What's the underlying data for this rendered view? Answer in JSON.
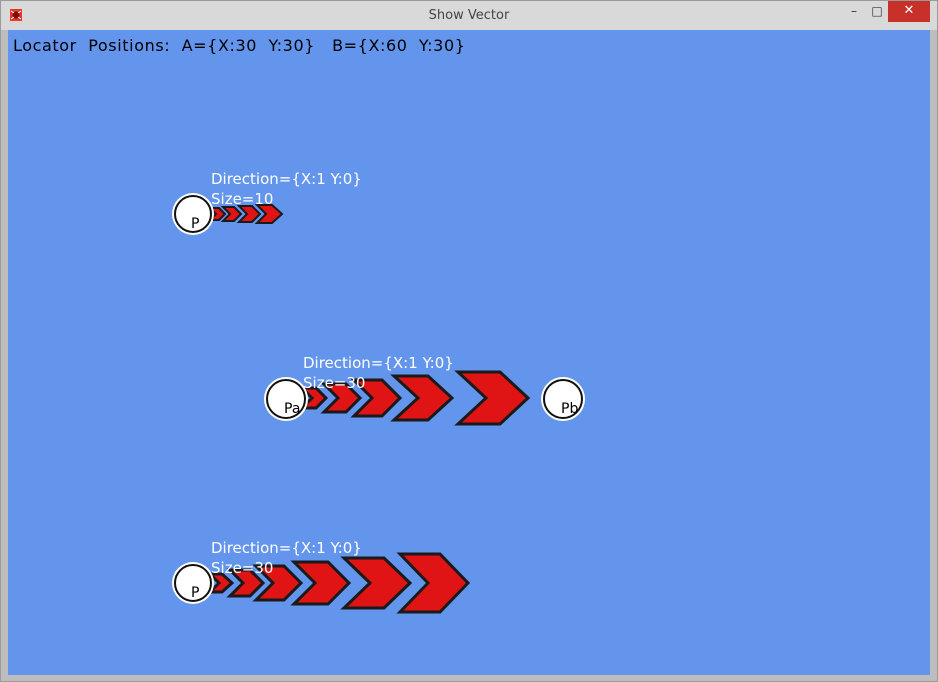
{
  "window": {
    "title": "Show Vector",
    "minimize_glyph": "–",
    "maximize_glyph": "□",
    "close_glyph": "✕",
    "app_icon": "bug-icon"
  },
  "canvas": {
    "background": "#6495ED",
    "locator_text": "Locator  Positions:  A={X:30  Y:30}   B={X:60  Y:30}"
  },
  "vectors": [
    {
      "direction_text": "Direction={X:1 Y:0}",
      "size_text": "Size=10",
      "start_label": "P",
      "end_label": null
    },
    {
      "direction_text": "Direction={X:1 Y:0}",
      "size_text": "Size=30",
      "start_label": "Pa",
      "end_label": "Pb"
    },
    {
      "direction_text": "Direction={X:1 Y:0}",
      "size_text": "Size=30",
      "start_label": "P",
      "end_label": null
    }
  ],
  "colors": {
    "chevron_fill": "#E01414",
    "chevron_outline": "#1A1A1A",
    "label_text": "#FFFFFF",
    "point_fill": "#FFFFFF"
  }
}
